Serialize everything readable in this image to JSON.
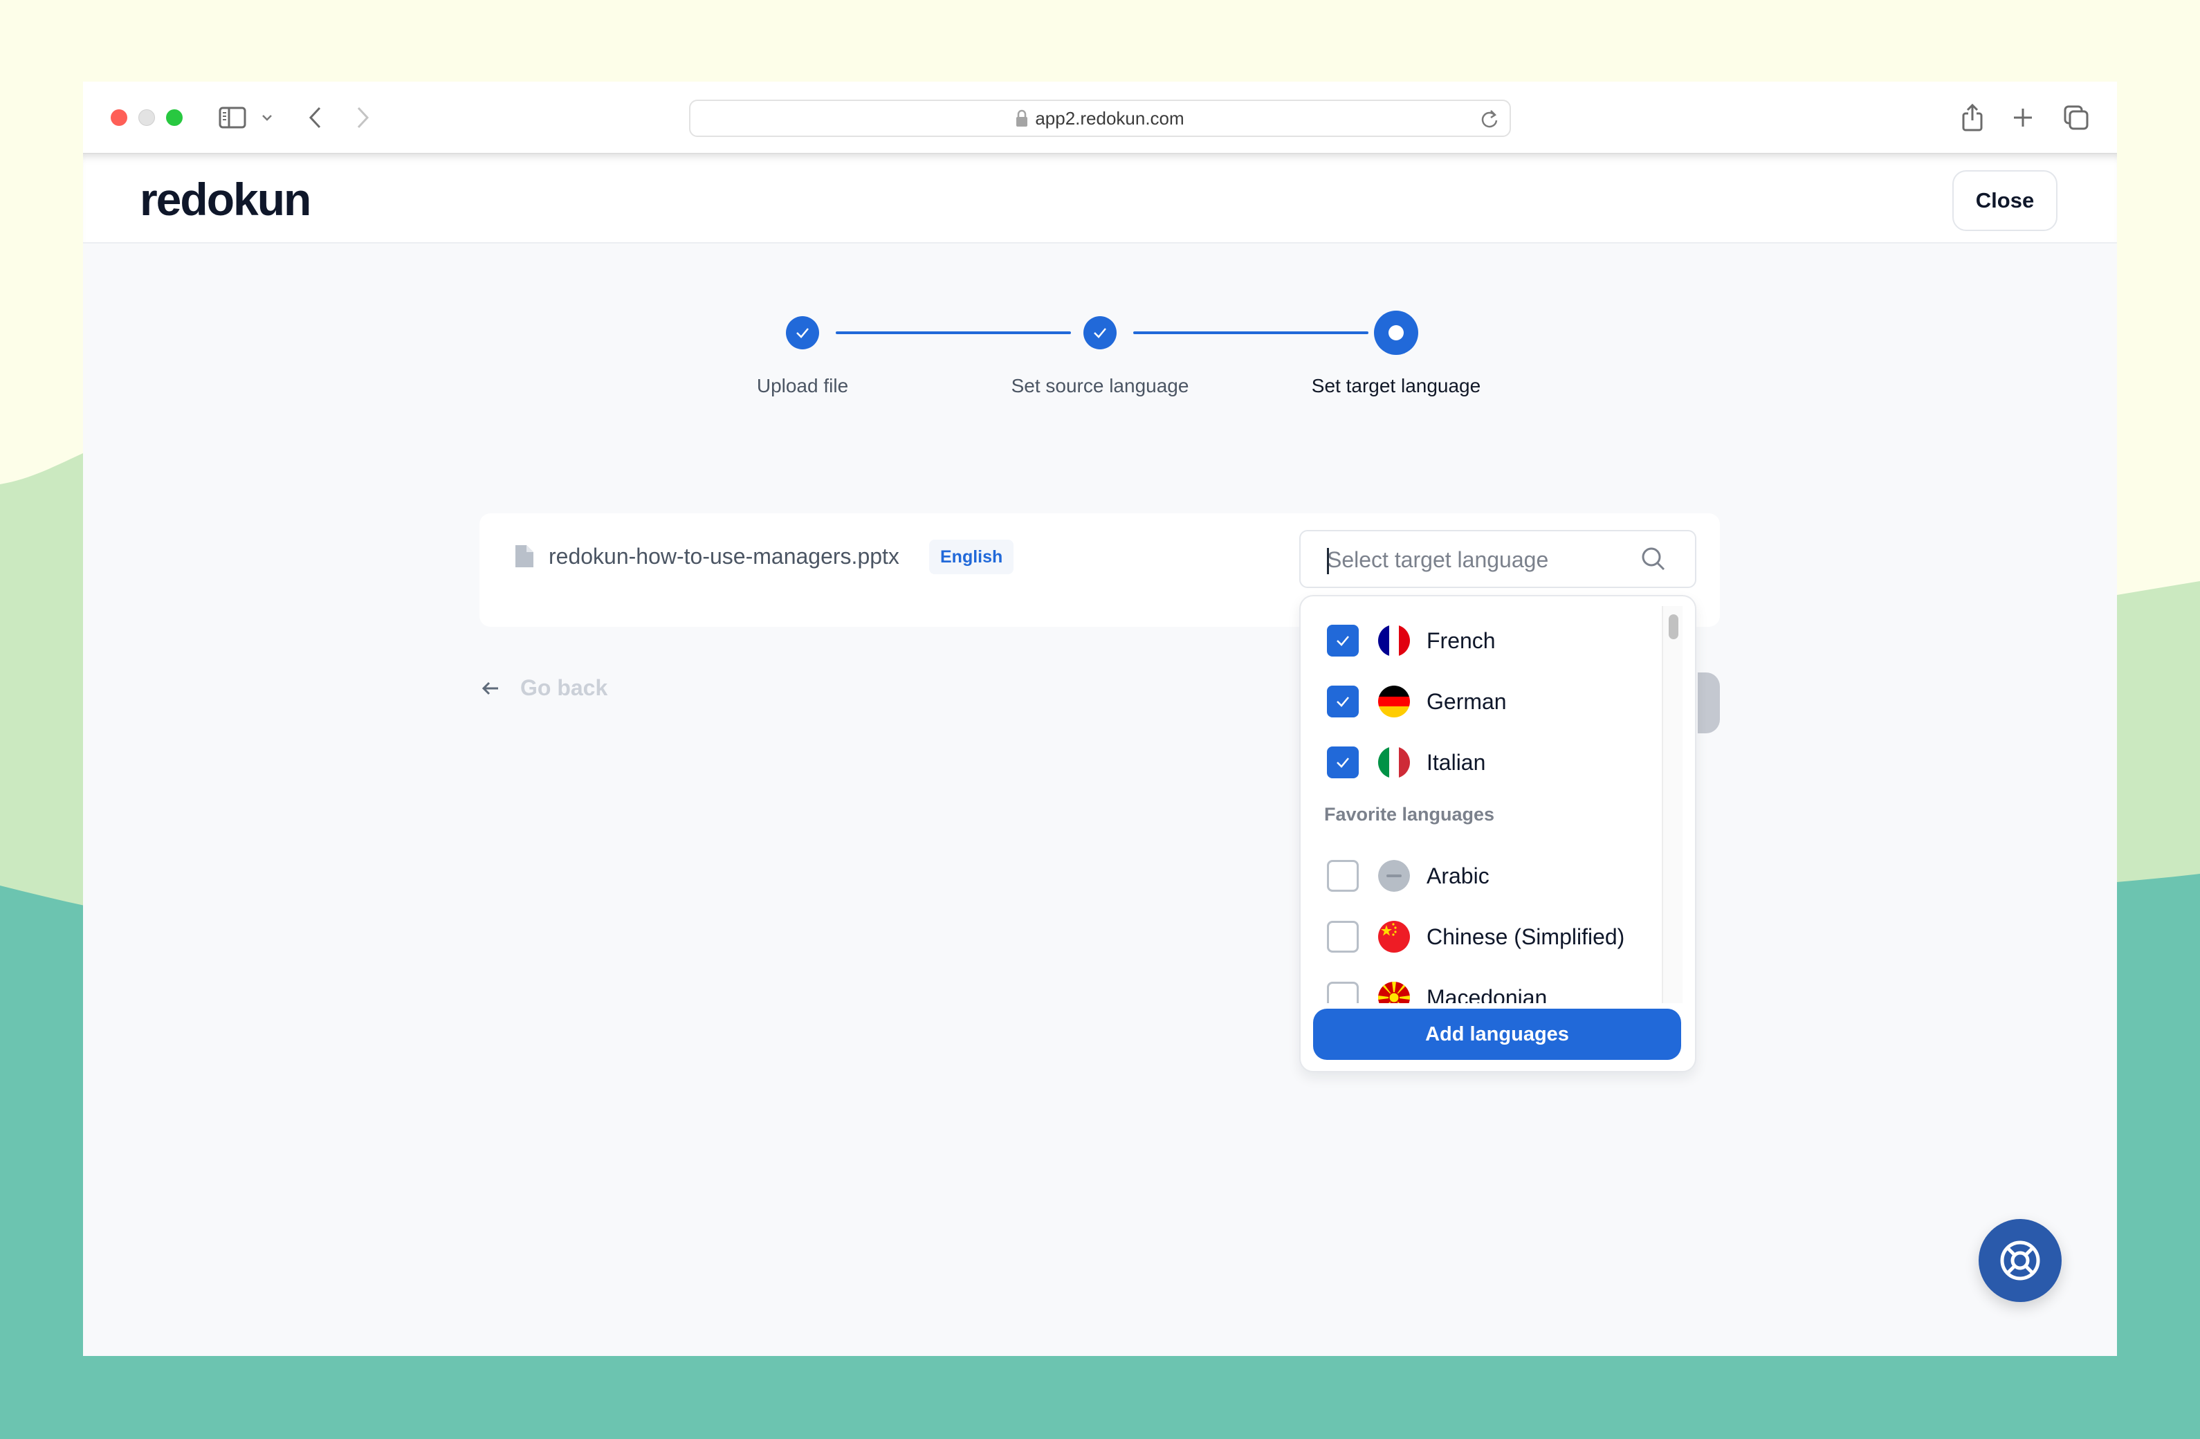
{
  "browser": {
    "url": "app2.redokun.com",
    "buttons": {
      "sidebar": "sidebar-toggle",
      "tab_overview_dropdown": "chevron-down",
      "back": "back",
      "forward": "forward",
      "share": "share",
      "new_tab": "new-tab",
      "tabs_overview": "tab-overview"
    }
  },
  "header": {
    "logo": "redokun",
    "close_label": "Close"
  },
  "stepper": {
    "steps": [
      {
        "label": "Upload file",
        "status": "complete"
      },
      {
        "label": "Set source language",
        "status": "complete"
      },
      {
        "label": "Set target language",
        "status": "current"
      }
    ]
  },
  "file": {
    "name": "redokun-how-to-use-managers.pptx",
    "source_language": "English"
  },
  "navigation": {
    "go_back_label": "Go back"
  },
  "language_picker": {
    "search_placeholder": "Select target language",
    "search_value": "",
    "selected": [
      {
        "label": "French",
        "checked": true,
        "flag": "fr"
      },
      {
        "label": "German",
        "checked": true,
        "flag": "de"
      },
      {
        "label": "Italian",
        "checked": true,
        "flag": "it"
      }
    ],
    "favorites_heading": "Favorite languages",
    "favorites": [
      {
        "label": "Arabic",
        "checked": false,
        "flag": "none"
      },
      {
        "label": "Chinese (Simplified)",
        "checked": false,
        "flag": "cn"
      },
      {
        "label": "Macedonian",
        "checked": false,
        "flag": "mk"
      }
    ],
    "add_button_label": "Add languages"
  },
  "help": {
    "icon": "lifebuoy"
  },
  "colors": {
    "accent": "#2169d9",
    "help_fab": "#2a5aab",
    "bg_cream": "#fdfee9",
    "bg_light_green": "#cbe9c0",
    "bg_teal": "#6cc4b0"
  }
}
